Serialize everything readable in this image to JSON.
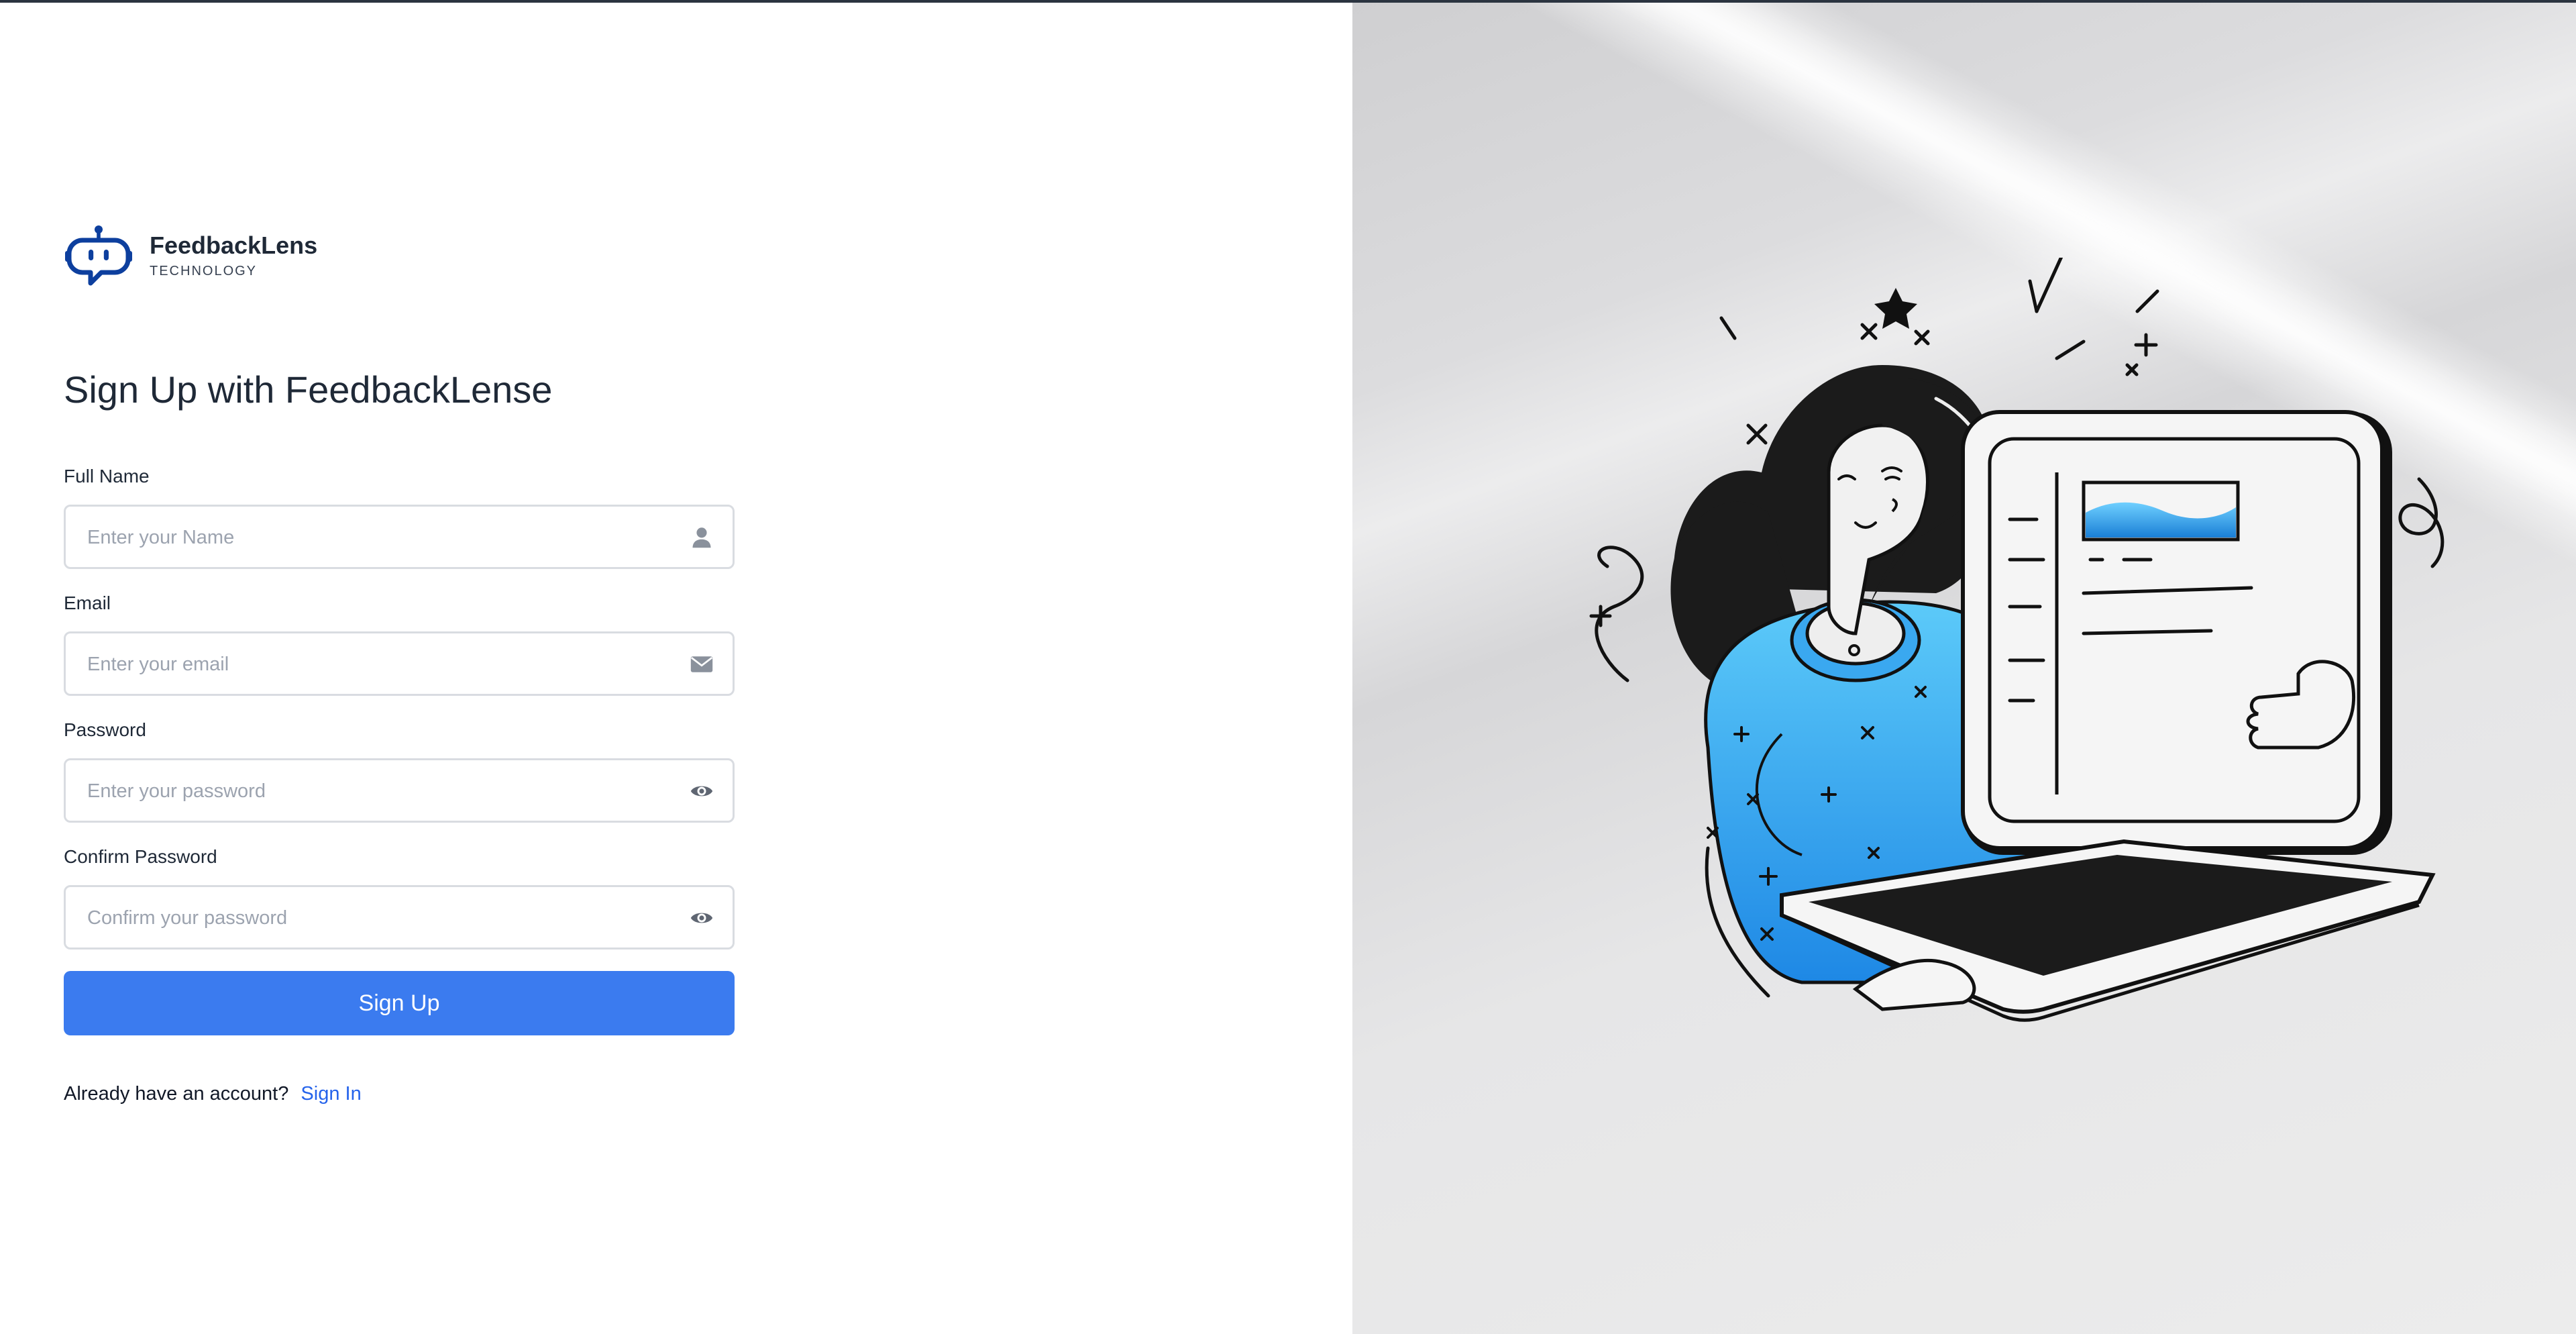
{
  "brand": {
    "name": "FeedbackLens",
    "tagline": "TECHNOLOGY",
    "accent_color": "#0d3f9e"
  },
  "form": {
    "title": "Sign Up with FeedbackLense",
    "fields": [
      {
        "label": "Full Name",
        "placeholder": "Enter your Name",
        "icon": "user-icon"
      },
      {
        "label": "Email",
        "placeholder": "Enter your email",
        "icon": "envelope-icon"
      },
      {
        "label": "Password",
        "placeholder": "Enter your password",
        "icon": "eye-icon"
      },
      {
        "label": "Confirm Password",
        "placeholder": "Confirm your password",
        "icon": "eye-icon"
      }
    ],
    "submit_label": "Sign Up",
    "button_color": "#3b7bef"
  },
  "footer": {
    "prompt": "Already have an account?",
    "link_label": "Sign In"
  },
  "illustration": {
    "subject": "woman-holding-laptop-illustration",
    "accent_color": "#3aa8f0"
  }
}
